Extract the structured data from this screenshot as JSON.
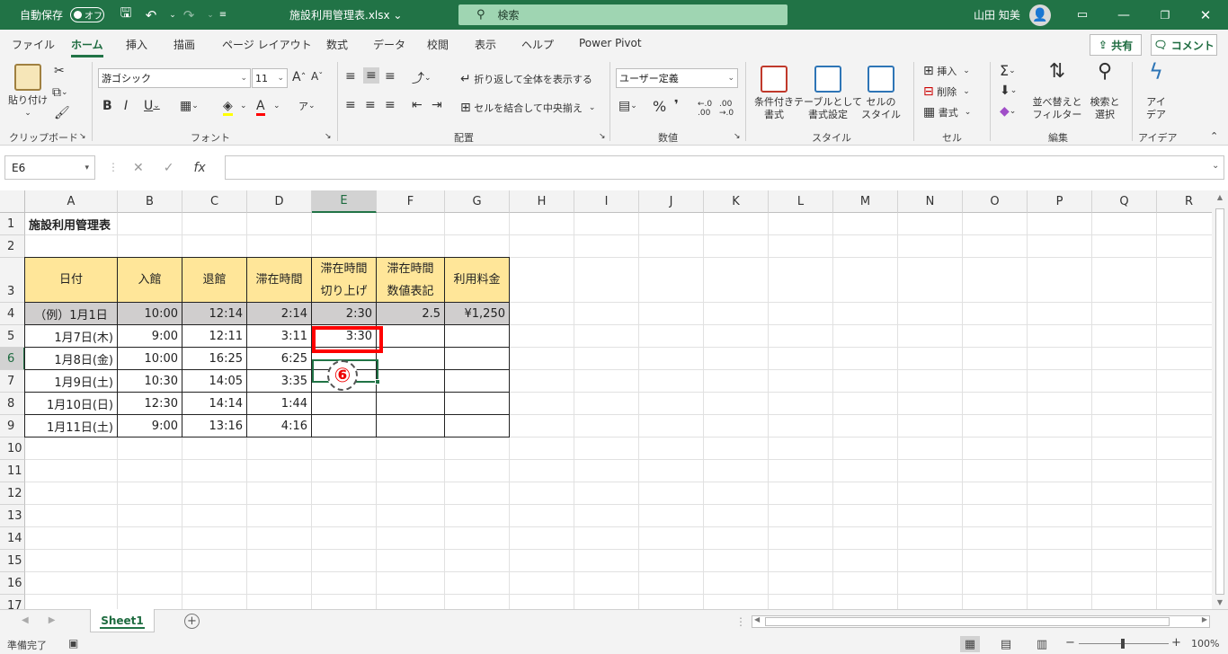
{
  "titlebar": {
    "autosave_label": "自動保存",
    "autosave_state": "オフ",
    "filename": "施設利用管理表.xlsx",
    "search_label": "検索",
    "user_name": "山田 知美"
  },
  "menu": {
    "tabs": [
      "ファイル",
      "ホーム",
      "挿入",
      "描画",
      "ページ レイアウト",
      "数式",
      "データ",
      "校閲",
      "表示",
      "ヘルプ",
      "Power Pivot"
    ],
    "active": "ホーム",
    "share": "共有",
    "comment": "コメント"
  },
  "ribbon": {
    "clipboard": {
      "paste": "貼り付け",
      "label": "クリップボード"
    },
    "font": {
      "name": "游ゴシック",
      "size": "11",
      "label": "フォント"
    },
    "alignment": {
      "wrap": "折り返して全体を表示する",
      "merge": "セルを結合して中央揃え",
      "label": "配置"
    },
    "number": {
      "format": "ユーザー定義",
      "label": "数値"
    },
    "styles": {
      "conditional": "条件付き\n書式",
      "table": "テーブルとして\n書式設定",
      "cell": "セルの\nスタイル",
      "label": "スタイル"
    },
    "cells": {
      "insert": "挿入",
      "delete": "削除",
      "format": "書式",
      "label": "セル"
    },
    "editing": {
      "sort": "並べ替えと\nフィルター",
      "find": "検索と\n選択",
      "label": "編集"
    },
    "ideas": {
      "btn": "アイ\nデア",
      "label": "アイデア"
    }
  },
  "formula": {
    "namebox": "E6",
    "content": ""
  },
  "columns": [
    "A",
    "B",
    "C",
    "D",
    "E",
    "F",
    "G",
    "H",
    "I",
    "J",
    "K",
    "L",
    "M",
    "N",
    "O",
    "P",
    "Q",
    "R"
  ],
  "selected_col": "E",
  "selected_row": "6",
  "rows": [
    "1",
    "2",
    "3",
    "4",
    "5",
    "6",
    "7",
    "8",
    "9",
    "10",
    "11",
    "12",
    "13",
    "14",
    "15",
    "16",
    "17"
  ],
  "sheet": {
    "title": "施設利用管理表",
    "headers": [
      "日付",
      "入館",
      "退館",
      "滞在時間",
      "滞在時間\n切り上げ",
      "滞在時間\n数値表記",
      "利用料金"
    ],
    "example": [
      "（例）1月1日",
      "10:00",
      "12:14",
      "2:14",
      "2:30",
      "2.5",
      "¥1,250"
    ],
    "data": [
      [
        "1月7日(木)",
        "9:00",
        "12:11",
        "3:11",
        "3:30",
        "",
        ""
      ],
      [
        "1月8日(金)",
        "10:00",
        "16:25",
        "6:25",
        "",
        "",
        ""
      ],
      [
        "1月9日(土)",
        "10:30",
        "14:05",
        "3:35",
        "",
        "",
        ""
      ],
      [
        "1月10日(日)",
        "12:30",
        "14:14",
        "1:44",
        "",
        "",
        ""
      ],
      [
        "1月11日(土)",
        "9:00",
        "13:16",
        "4:16",
        "",
        "",
        ""
      ]
    ]
  },
  "annotation": {
    "step": "⑥"
  },
  "sheet_tabs": [
    "Sheet1"
  ],
  "status": {
    "ready": "準備完了",
    "zoom": "100%"
  }
}
